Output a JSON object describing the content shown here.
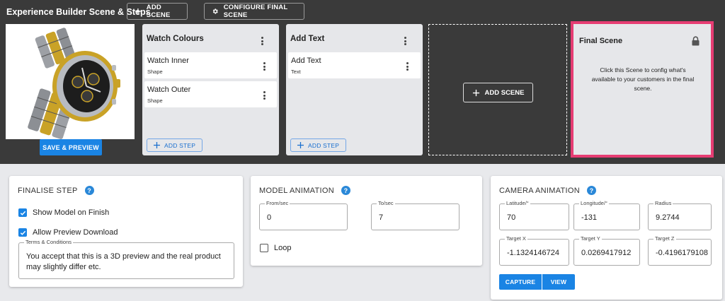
{
  "header": {
    "title": "Experience Builder Scene & Steps",
    "add_scene": "ADD SCENE",
    "configure_final_scene": "CONFIGURE FINAL SCENE"
  },
  "preview": {
    "save_preview": "SAVE & PREVIEW"
  },
  "scenes": [
    {
      "title": "Watch Colours",
      "steps": [
        {
          "title": "Watch Inner",
          "type": "Shape"
        },
        {
          "title": "Watch Outer",
          "type": "Shape"
        }
      ],
      "add_step": "ADD STEP"
    },
    {
      "title": "Add Text",
      "steps": [
        {
          "title": "Add Text",
          "type": "Text"
        }
      ],
      "add_step": "ADD STEP"
    }
  ],
  "add_scene_placeholder": "ADD SCENE",
  "final_scene": {
    "title": "Final Scene",
    "description": "Click this Scene to config what's available to your customers in the final scene."
  },
  "finalise_step": {
    "title": "FINALISE STEP",
    "show_model": "Show Model on Finish",
    "show_model_checked": true,
    "allow_download": "Allow Preview Download",
    "allow_download_checked": true,
    "terms_label": "Terms & Conditions",
    "terms_value": "You accept that this is a 3D preview and the real product may slightly differ etc."
  },
  "model_animation": {
    "title": "MODEL ANIMATION",
    "from_label": "From/sec",
    "from_value": "0",
    "to_label": "To/sec",
    "to_value": "7",
    "loop_label": "Loop",
    "loop_checked": false
  },
  "camera_animation": {
    "title": "CAMERA ANIMATION",
    "latitude_label": "Latitude/°",
    "latitude_value": "70",
    "longitude_label": "Longitude/°",
    "longitude_value": "-131",
    "radius_label": "Radius",
    "radius_value": "9.2744",
    "target_x_label": "Target X",
    "target_x_value": "-1.1324146724",
    "target_y_label": "Target Y",
    "target_y_value": "0.0269417912",
    "target_z_label": "Target Z",
    "target_z_value": "-0.4196179108",
    "capture": "CAPTURE",
    "view": "VIEW"
  },
  "colors": {
    "accent_blue": "#1a84e4",
    "final_border": "#e63d73",
    "dark_band": "#3a3a3a"
  }
}
